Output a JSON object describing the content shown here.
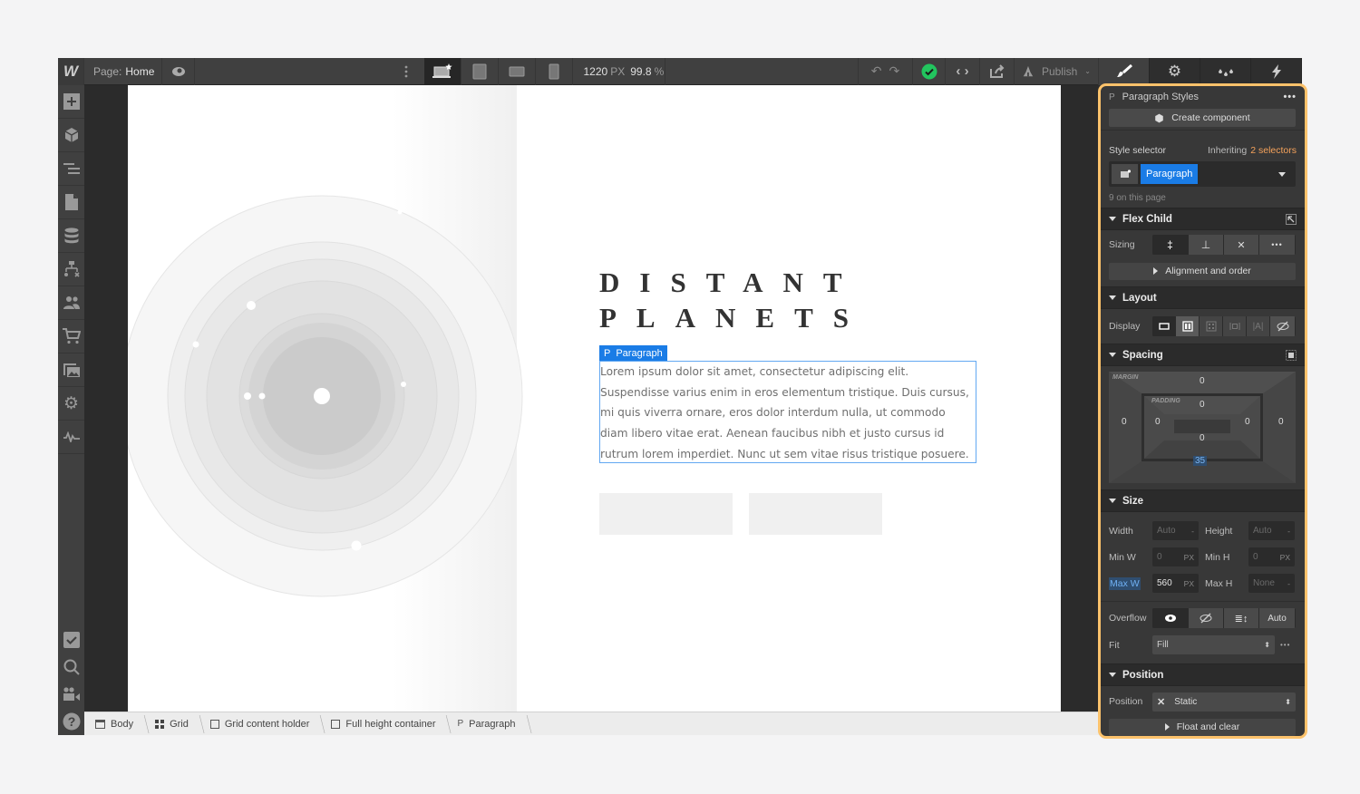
{
  "topbar": {
    "logo": "W",
    "page_key": "Page:",
    "page_value": "Home",
    "width_value": "1220",
    "width_unit": "PX",
    "zoom_value": "99.8",
    "zoom_unit": "%",
    "publish_label": "Publish",
    "status_color": "#22c55e"
  },
  "canvas": {
    "heading_line1": "DISTANT",
    "heading_line2": "PLANETS",
    "selected_tag_icon": "P",
    "selected_tag_label": "Paragraph",
    "paragraph": "Lorem ipsum dolor sit amet, consectetur adipiscing elit. Suspendisse varius enim in eros elementum tristique. Duis cursus, mi quis viverra ornare, eros dolor interdum nulla, ut commodo diam libero vitae erat. Aenean faucibus nibh et justo cursus id rutrum lorem imperdiet. Nunc ut sem vitae risus tristique posuere."
  },
  "breadcrumbs": [
    {
      "icon": "body-icon",
      "label": "Body"
    },
    {
      "icon": "grid-icon",
      "label": "Grid"
    },
    {
      "icon": "box-icon",
      "label": "Grid content holder"
    },
    {
      "icon": "box-icon",
      "label": "Full height container"
    },
    {
      "icon": "paragraph-icon",
      "label": "Paragraph"
    }
  ],
  "panel": {
    "element_icon": "P",
    "element_title": "Paragraph Styles",
    "create_component": "Create component",
    "style_selector_label": "Style selector",
    "inheriting_prefix": "Inheriting",
    "inheriting_link": "2 selectors",
    "selector_chip": "Paragraph",
    "on_page": "9 on this page",
    "flex_child": {
      "title": "Flex Child",
      "sizing_label": "Sizing",
      "alignment_label": "Alignment and order"
    },
    "layout": {
      "title": "Layout",
      "display_label": "Display"
    },
    "spacing": {
      "title": "Spacing",
      "margin_label": "MARGIN",
      "padding_label": "PADDING",
      "margin_top": "0",
      "margin_right": "0",
      "margin_bottom": "35",
      "margin_left": "0",
      "padding_top": "0",
      "padding_right": "0",
      "padding_bottom": "0",
      "padding_left": "0"
    },
    "size": {
      "title": "Size",
      "width_label": "Width",
      "width_value": "Auto",
      "width_unit": "-",
      "height_label": "Height",
      "height_value": "Auto",
      "height_unit": "-",
      "minw_label": "Min W",
      "minw_value": "0",
      "minw_unit": "PX",
      "minh_label": "Min H",
      "minh_value": "0",
      "minh_unit": "PX",
      "maxw_label": "Max W",
      "maxw_value": "560",
      "maxw_unit": "PX",
      "maxh_label": "Max H",
      "maxh_value": "None",
      "maxh_unit": "-",
      "overflow_label": "Overflow",
      "overflow_auto": "Auto",
      "fit_label": "Fit",
      "fit_value": "Fill"
    },
    "position": {
      "title": "Position",
      "position_label": "Position",
      "position_value": "Static",
      "float_label": "Float and clear"
    }
  },
  "colors": {
    "accent": "#1a7ce6",
    "highlight_border": "#fcc26b",
    "link_orange": "#f5a25b"
  }
}
